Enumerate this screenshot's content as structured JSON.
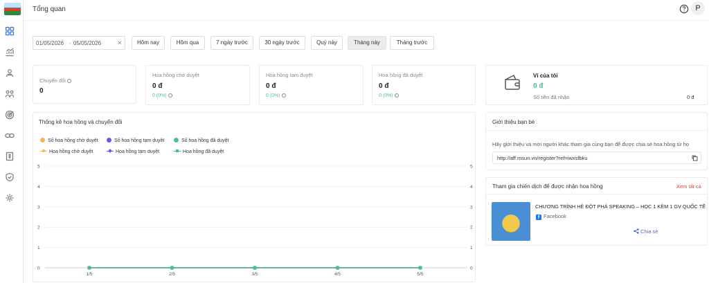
{
  "header": {
    "title": "Tổng quan",
    "avatar_initial": "P"
  },
  "filters": {
    "date_start": "01/05/2026",
    "date_separator": "-",
    "date_end": "05/05/2026",
    "clear": "✕",
    "buttons": [
      {
        "label": "Hôm nay"
      },
      {
        "label": "Hôm qua"
      },
      {
        "label": "7 ngày trước"
      },
      {
        "label": "30 ngày trước"
      },
      {
        "label": "Quý này"
      },
      {
        "label": "Tháng này",
        "active": true
      },
      {
        "label": "Tháng trước"
      }
    ]
  },
  "stats": [
    {
      "label": "Chuyển đổi",
      "value": "0"
    },
    {
      "label": "Hoa hồng chờ duyệt",
      "value": "0 đ",
      "percent": "0 (0%)"
    },
    {
      "label": "Hoa hồng tạm duyệt",
      "value": "0 đ",
      "percent": "0 (0%)"
    },
    {
      "label": "Hoa hồng đã duyệt",
      "value": "0 đ",
      "percent": "0 (0%)"
    }
  ],
  "wallet": {
    "title": "Ví của tôi",
    "balance": "0 đ",
    "received_label": "Số tiền đã nhận",
    "received_value": "0 đ",
    "accent": "#4bbf8b"
  },
  "chart_section": {
    "title": "Thống kê hoa hồng và chuyển đổi"
  },
  "referral": {
    "title": "Giới thiệu bạn bè",
    "description": "Hãy giới thiệu và mời người khác tham gia cùng bạn để được chia sẻ hoa hồng từ họ",
    "link": "http://aff.msun.vn/register?ref=iwxsfbku"
  },
  "campaigns": {
    "title": "Tham gia chiến dịch để được nhận hoa hồng",
    "view_all": "Xem tất cả",
    "items": [
      {
        "name": "CHƯƠNG TRÌNH HÈ ĐỘT PHÁ SPEAKING – HỌC 1 KÈM 1 GV QUỐC TẾ",
        "platform": "Facebook",
        "share_label": "Chia sẻ"
      }
    ]
  },
  "chart_data": {
    "type": "line",
    "categories": [
      "1/5",
      "2/5",
      "3/5",
      "4/5",
      "5/5"
    ],
    "series": [
      {
        "name": "Số hoa hồng chờ duyệt",
        "kind": "bar",
        "color": "#f0b263",
        "values": [
          0,
          0,
          0,
          0,
          0
        ]
      },
      {
        "name": "Số hoa hồng tạm duyệt",
        "kind": "bar",
        "color": "#6f56d9",
        "values": [
          0,
          0,
          0,
          0,
          0
        ]
      },
      {
        "name": "Số hoa hồng đã duyệt",
        "kind": "bar",
        "color": "#4bbf8b",
        "values": [
          0,
          0,
          0,
          0,
          0
        ]
      },
      {
        "name": "Hoa hồng chờ duyệt",
        "kind": "line",
        "color": "#f0b263",
        "marker": "circle",
        "values": [
          0,
          0,
          0,
          0,
          0
        ]
      },
      {
        "name": "Hoa hồng tạm duyệt",
        "kind": "line",
        "color": "#6f56d9",
        "marker": "diamond",
        "values": [
          0,
          0,
          0,
          0,
          0
        ]
      },
      {
        "name": "Hoa hồng đã duyệt",
        "kind": "line",
        "color": "#4bbf8b",
        "marker": "square",
        "values": [
          0,
          0,
          0,
          0,
          0
        ]
      }
    ],
    "y_left": {
      "ticks": [
        "0",
        "1",
        "2",
        "3",
        "4",
        "5"
      ],
      "range": [
        0,
        5
      ]
    },
    "y_right": {
      "ticks": [
        "0",
        "1",
        "2",
        "3",
        "4",
        "5"
      ],
      "range": [
        0,
        5
      ]
    },
    "grid": true,
    "legend_position": "top-left"
  }
}
